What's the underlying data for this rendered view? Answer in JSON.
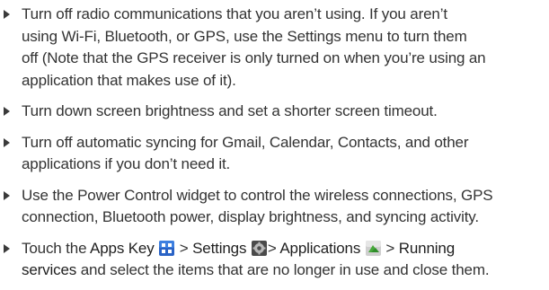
{
  "tips": [
    {
      "lines": [
        "Turn off radio communications that you aren’t using. If you aren’t",
        "using Wi-Fi, Bluetooth, or GPS, use the Settings menu to turn them",
        "off (Note that the GPS receiver is only turned on when you’re using an",
        "application that makes use of it)."
      ]
    },
    {
      "lines": [
        "Turn down screen brightness and set a shorter screen timeout."
      ]
    },
    {
      "lines": [
        "Turn off automatic syncing for Gmail, Calendar, Contacts, and other",
        "applications if you don’t need it."
      ]
    },
    {
      "lines": [
        "Use the Power Control widget to control the wireless connections, GPS",
        "connection, Bluetooth power, display brightness, and syncing activity."
      ]
    }
  ],
  "last_tip": {
    "touch": "Touch the",
    "apps_key": "Apps Key",
    "apps_icon": "apps-grid-icon",
    "gt1": ">",
    "settings": "Settings",
    "settings_icon": "settings-gear-icon",
    "gt2": ">",
    "applications": "Applications",
    "applications_icon": "applications-icon",
    "gt3": ">",
    "running": "Running",
    "services": "services",
    "rest": "and select the items  that are no longer in use and close them."
  }
}
